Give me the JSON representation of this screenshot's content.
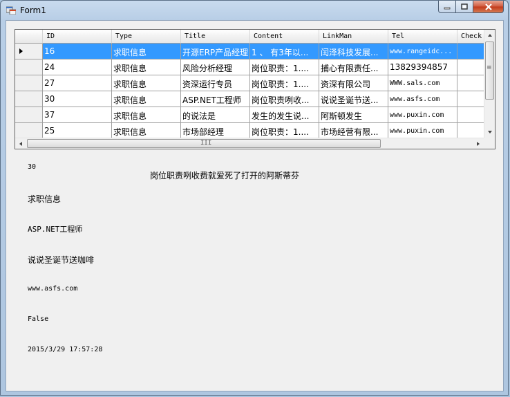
{
  "window": {
    "title": "Form1"
  },
  "grid": {
    "columns": [
      "ID",
      "Type",
      "Title",
      "Content",
      "LinkMan",
      "Tel",
      "Check"
    ],
    "rows": [
      [
        "16",
        "求职信息",
        "开源ERP产品经理",
        "1 、 有3年以...",
        "闰泽科技发展...",
        "www.rangeidc...",
        ""
      ],
      [
        "24",
        "求职信息",
        "风险分析经理",
        "岗位职责：1....",
        "捕心有限责任...",
        "13829394857",
        ""
      ],
      [
        "27",
        "求职信息",
        "资深运行专员",
        "岗位职责：1....",
        "资深有限公司",
        "WWW.sals.com",
        ""
      ],
      [
        "30",
        "求职信息",
        "ASP.NET工程师",
        "岗位职责咧收...",
        "说说圣诞节送...",
        "www.asfs.com",
        ""
      ],
      [
        "37",
        "求职信息",
        "的说法是",
        "发生的发生说...",
        "阿斯顿发生",
        "www.puxin.com",
        ""
      ],
      [
        "25",
        "求职信息",
        "市场部经理",
        "岗位职责：1....",
        "市场经营有限...",
        "www.puxin.com",
        ""
      ]
    ],
    "selected_row": 0,
    "hscroll_grip": "III",
    "vscroll_grip": "≡"
  },
  "details": {
    "id": "30",
    "content": "岗位职责咧收费就爱死了打开的阿斯蒂芬",
    "type": "求职信息",
    "title": "ASP.NET工程师",
    "linkman": "说说圣诞节送咖啡",
    "tel": "www.asfs.com",
    "check": "False",
    "date": "2015/3/29 17:57:28"
  },
  "colors": {
    "selection": "#3399ff",
    "form_bg": "#f0f0f0"
  }
}
